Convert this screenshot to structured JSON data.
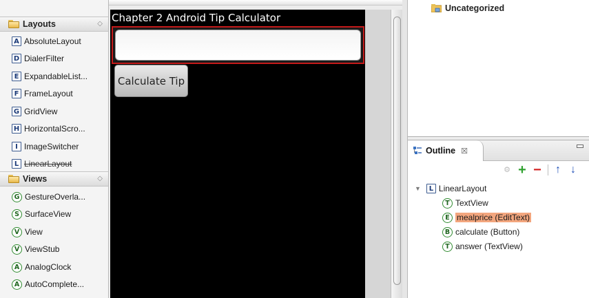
{
  "palette": {
    "layouts_header": "Layouts",
    "layouts_items": [
      {
        "icon": "A",
        "label": "AbsoluteLayout"
      },
      {
        "icon": "D",
        "label": "DialerFilter"
      },
      {
        "icon": "E",
        "label": "ExpandableList..."
      },
      {
        "icon": "F",
        "label": "FrameLayout"
      },
      {
        "icon": "G",
        "label": "GridView"
      },
      {
        "icon": "H",
        "label": "HorizontalScro..."
      },
      {
        "icon": "I",
        "label": "ImageSwitcher"
      },
      {
        "icon": "L",
        "label": "LinearLayout"
      }
    ],
    "views_header": "Views",
    "views_items": [
      {
        "icon": "G",
        "label": "GestureOverla..."
      },
      {
        "icon": "S",
        "label": "SurfaceView"
      },
      {
        "icon": "V",
        "label": "View"
      },
      {
        "icon": "V",
        "label": "ViewStub"
      },
      {
        "icon": "A",
        "label": "AnalogClock"
      },
      {
        "icon": "A",
        "label": "AutoComplete..."
      }
    ],
    "collapse_icon": "collapse-icon"
  },
  "canvas": {
    "app_title": "Chapter 2 Android Tip Calculator",
    "edittext_value": "",
    "button_label": "Calculate Tip"
  },
  "right_top": {
    "category_label": "Uncategorized"
  },
  "outline": {
    "tab_label": "Outline",
    "tab_close_glyph": "☒",
    "tree": [
      {
        "icon": "L",
        "label": "LinearLayout",
        "level": 0
      },
      {
        "icon": "T",
        "label": "TextView",
        "level": 1
      },
      {
        "icon": "E",
        "label": "mealprice (EditText)",
        "level": 1,
        "selected": true
      },
      {
        "icon": "B",
        "label": "calculate (Button)",
        "level": 1
      },
      {
        "icon": "T",
        "label": "answer (TextView)",
        "level": 1
      }
    ],
    "toolbar": {
      "add_glyph": "+",
      "remove_glyph": "−",
      "up_glyph": "↑",
      "down_glyph": "↓"
    }
  },
  "colors": {
    "selection": "#f3a67e",
    "edittext_border": "#c51a1a",
    "canvas_bg": "#000000"
  }
}
